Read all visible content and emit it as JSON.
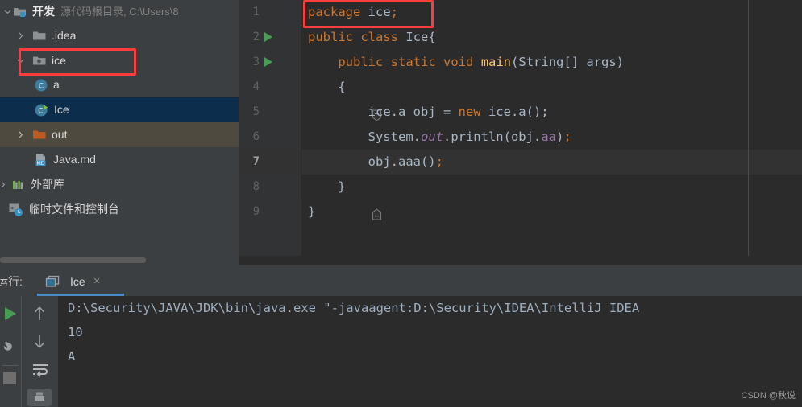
{
  "project_tree": {
    "items": [
      {
        "label": "开发",
        "sub": "源代码根目录, C:\\Users\\8",
        "icon": "module-folder-icon",
        "arrow": "chevron-down-icon",
        "indent": 0,
        "state": "normal"
      },
      {
        "label": ".idea",
        "sub": "",
        "icon": "folder-icon",
        "arrow": "chevron-right-icon",
        "indent": 1,
        "state": "normal"
      },
      {
        "label": "ice",
        "sub": "",
        "icon": "package-icon",
        "arrow": "chevron-down-icon",
        "indent": 1,
        "state": "annotated"
      },
      {
        "label": "a",
        "sub": "",
        "icon": "java-class-icon",
        "arrow": "",
        "indent": 2,
        "state": "normal"
      },
      {
        "label": "Ice",
        "sub": "",
        "icon": "java-runnable-class-icon",
        "arrow": "",
        "indent": 2,
        "state": "selected"
      },
      {
        "label": "out",
        "sub": "",
        "icon": "excluded-folder-icon",
        "arrow": "chevron-right-icon",
        "indent": 1,
        "state": "hovered"
      },
      {
        "label": "Java.md",
        "sub": "",
        "icon": "markdown-file-icon",
        "arrow": "",
        "indent": 2,
        "state": "normal"
      },
      {
        "label": "外部库",
        "sub": "",
        "icon": "libraries-icon",
        "arrow": "chevron-right-icon",
        "indent": 0,
        "state": "normal"
      },
      {
        "label": "临时文件和控制台",
        "sub": "",
        "icon": "scratches-console-icon",
        "arrow": "",
        "indent": 0,
        "state": "normal"
      }
    ]
  },
  "editor": {
    "lines": [
      {
        "num": "1",
        "gutter": "none",
        "fold": "none",
        "current": false,
        "annotated": true,
        "tokens": [
          {
            "t": "package",
            "c": "kw"
          },
          {
            "t": " ",
            "c": "pn"
          },
          {
            "t": "ice",
            "c": "id"
          },
          {
            "t": ";",
            "c": "semi"
          }
        ]
      },
      {
        "num": "2",
        "gutter": "run-arrow-icon",
        "fold": "line",
        "current": false,
        "annotated": false,
        "tokens": [
          {
            "t": "public",
            "c": "kw"
          },
          {
            "t": " ",
            "c": "pn"
          },
          {
            "t": "class",
            "c": "kw"
          },
          {
            "t": " ",
            "c": "pn"
          },
          {
            "t": "Ice",
            "c": "id"
          },
          {
            "t": "{",
            "c": "pn"
          }
        ]
      },
      {
        "num": "3",
        "gutter": "run-arrow-icon",
        "fold": "line",
        "current": false,
        "annotated": false,
        "tokens": [
          {
            "t": "    public",
            "c": "kw"
          },
          {
            "t": " ",
            "c": "pn"
          },
          {
            "t": "static",
            "c": "kw"
          },
          {
            "t": " ",
            "c": "pn"
          },
          {
            "t": "void",
            "c": "kw"
          },
          {
            "t": " ",
            "c": "pn"
          },
          {
            "t": "main",
            "c": "fn"
          },
          {
            "t": "(",
            "c": "pn"
          },
          {
            "t": "String",
            "c": "id"
          },
          {
            "t": "[] ",
            "c": "pn"
          },
          {
            "t": "args",
            "c": "id"
          },
          {
            "t": ")",
            "c": "pn"
          }
        ]
      },
      {
        "num": "4",
        "gutter": "none",
        "fold": "collapse-top-icon",
        "current": false,
        "annotated": false,
        "tokens": [
          {
            "t": "    {",
            "c": "pn"
          }
        ]
      },
      {
        "num": "5",
        "gutter": "none",
        "fold": "line",
        "current": false,
        "annotated": false,
        "tokens": [
          {
            "t": "        ice.a obj = ",
            "c": "id"
          },
          {
            "t": "new",
            "c": "kw"
          },
          {
            "t": " ice.a();",
            "c": "id"
          }
        ]
      },
      {
        "num": "6",
        "gutter": "none",
        "fold": "line",
        "current": false,
        "annotated": false,
        "tokens": [
          {
            "t": "        System.",
            "c": "id"
          },
          {
            "t": "out",
            "c": "st"
          },
          {
            "t": ".println(obj.",
            "c": "id"
          },
          {
            "t": "aa",
            "c": "fld"
          },
          {
            "t": ")",
            "c": "pn"
          },
          {
            "t": ";",
            "c": "semi"
          }
        ]
      },
      {
        "num": "7",
        "gutter": "none",
        "fold": "line",
        "current": true,
        "annotated": false,
        "tokens": [
          {
            "t": "        obj.aaa()",
            "c": "id"
          },
          {
            "t": ";",
            "c": "semi"
          }
        ]
      },
      {
        "num": "8",
        "gutter": "none",
        "fold": "collapse-bottom-icon",
        "current": false,
        "annotated": false,
        "tokens": [
          {
            "t": "    }",
            "c": "pn"
          }
        ]
      },
      {
        "num": "9",
        "gutter": "none",
        "fold": "none",
        "current": false,
        "annotated": false,
        "tokens": [
          {
            "t": "}",
            "c": "pn"
          }
        ]
      }
    ]
  },
  "run_panel": {
    "title": "运行:",
    "tab_label": "Ice",
    "tab_close": "×",
    "tab_icon": "run-config-icon",
    "toolbar": {
      "run_icon": "run-green-arrow-icon",
      "settings_icon": "wrench-icon",
      "stop_icon": "stop-square-icon",
      "up_icon": "arrow-up-icon",
      "down_icon": "arrow-down-icon",
      "soft_wrap_icon": "soft-wrap-icon",
      "print_icon": "print-icon"
    },
    "console_lines": [
      {
        "text": "D:\\Security\\JAVA\\JDK\\bin\\java.exe \"-javaagent:D:\\Security\\IDEA\\IntelliJ IDEA",
        "kind": "cmd"
      },
      {
        "text": "10",
        "kind": "out"
      },
      {
        "text": "A",
        "kind": "out"
      }
    ]
  },
  "watermark": {
    "text": "CSDN @秋说"
  },
  "colors": {
    "keyword": "#cc7832",
    "method": "#ffc66d",
    "static_field": "#9876aa",
    "identifier": "#a9b7c6",
    "editor_bg": "#2b2b2b",
    "panel_bg": "#3c3f41",
    "selection": "#0d2d4d",
    "annotation": "#fc3d3d",
    "tab_underline": "#4a88c7",
    "run_green": "#499c54"
  }
}
